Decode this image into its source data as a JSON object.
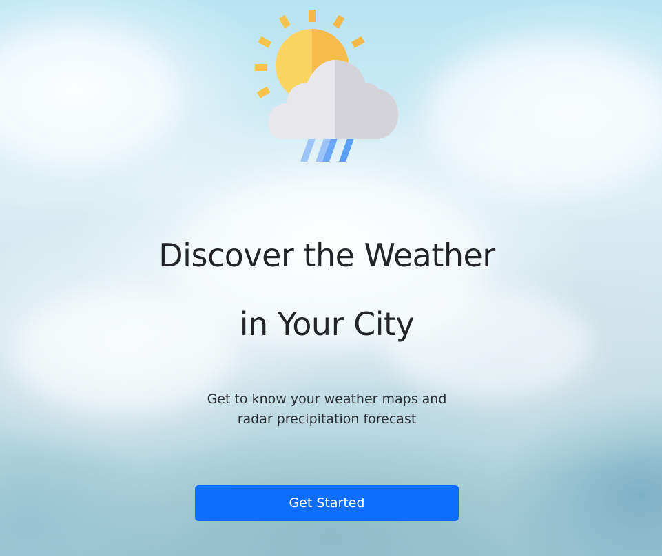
{
  "hero": {
    "icon": "sun-cloud-rain-icon",
    "title_line1": "Discover the Weather",
    "title_line2": "in Your City",
    "subtitle_line1": "Get to know your weather maps and",
    "subtitle_line2": "radar precipitation forecast",
    "button_label": "Get Started"
  },
  "colors": {
    "accent": "#0d6efd",
    "heading_text": "#222428",
    "sun": "#f8c34a",
    "cloud": "#e8e8ec",
    "rain": "#5aa0f5"
  }
}
